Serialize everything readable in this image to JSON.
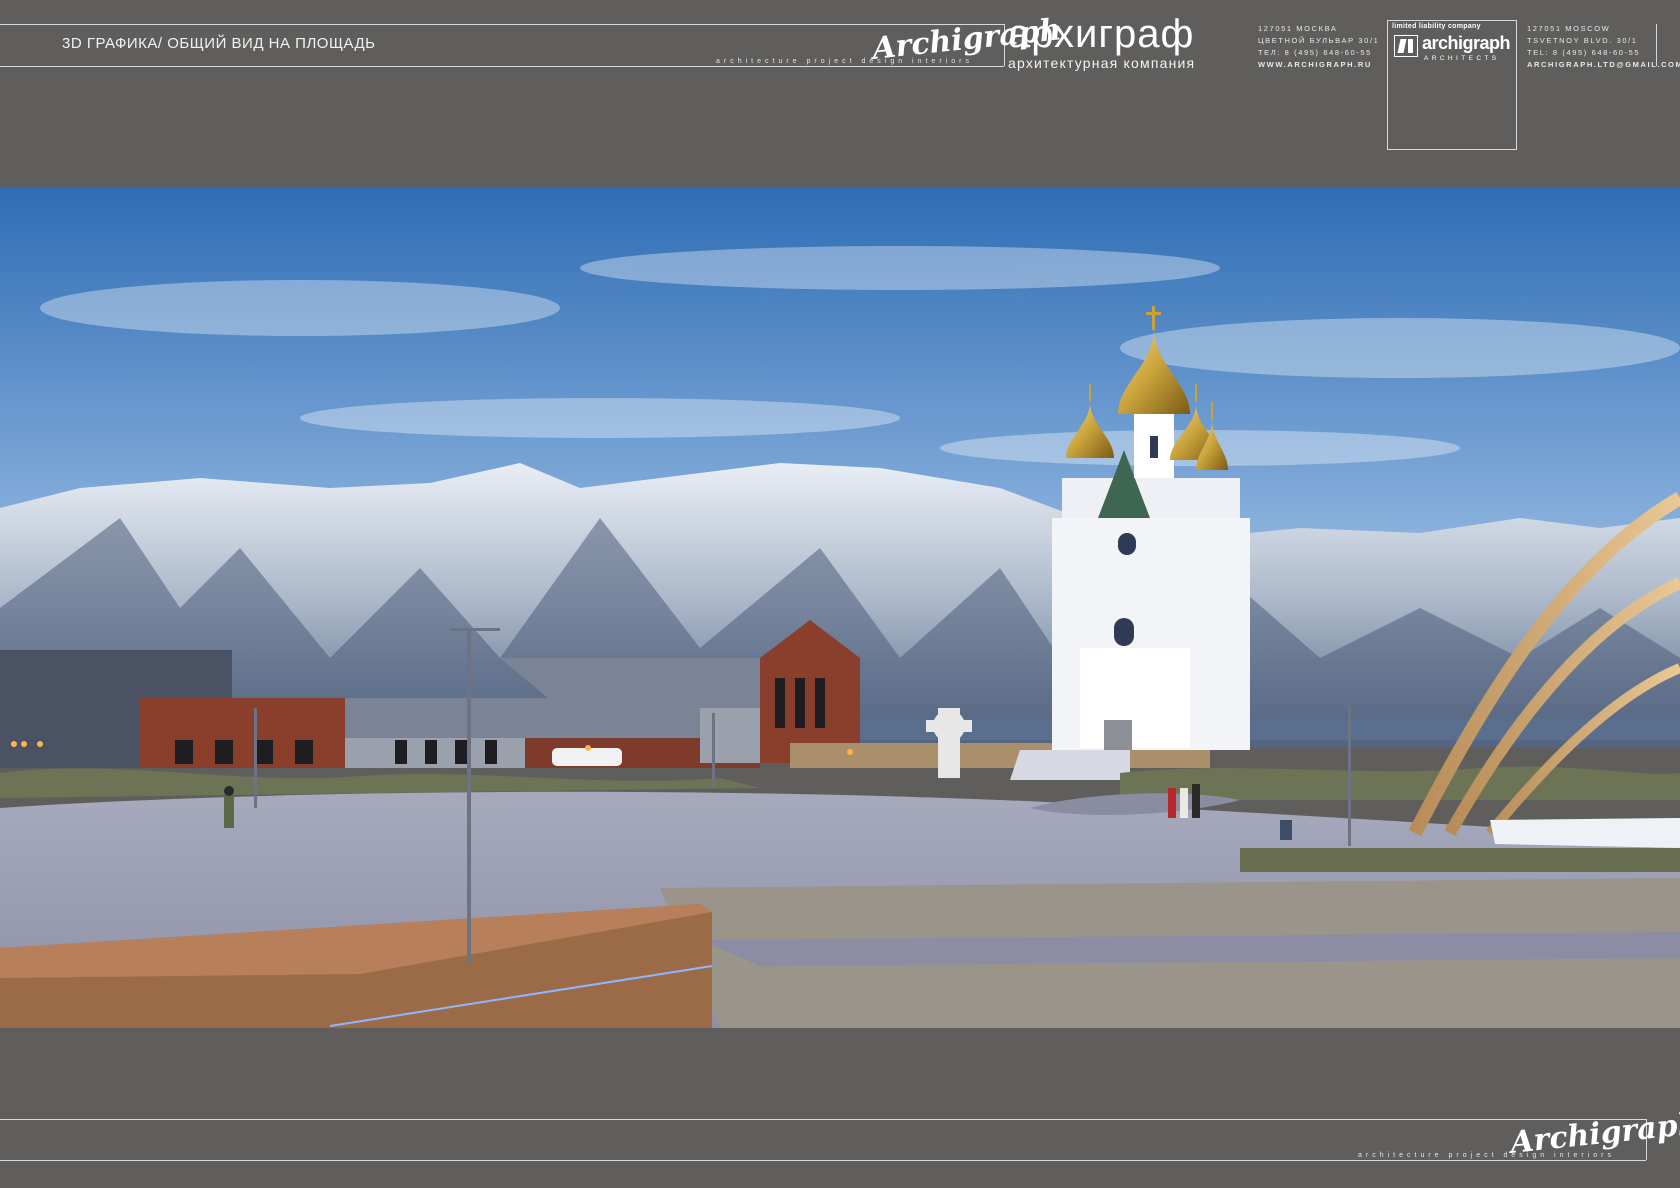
{
  "sheet": {
    "title": "3D ГРАФИКА/  ОБЩИЙ ВИД НА ПЛОЩАДЬ"
  },
  "studio": {
    "signature": "Archigraph",
    "tagline": "architecture project design interiors",
    "name_ru": "архиграф",
    "subtitle_ru": "архитектурная компания",
    "address_ru": [
      "127051 МОСКВА",
      "ЦВЕТНОЙ БУЛЬВАР 30/1",
      "ТЕЛ: 8 (495) 648-60-55",
      "WWW.ARCHIGRAPH.RU"
    ],
    "address_en": [
      "127051 MOSCOW",
      "TSVETNOY BLVD. 30/1",
      "TEL: 8 (495) 648-60-55",
      "ARCHIGRAPH.LTD@GMAIL.COM"
    ],
    "logo_caption": "limited liability company",
    "logo_word": "archigraph",
    "logo_sub": "ARCHITECTS"
  },
  "colors": {
    "background": "#5f5e5c",
    "frame_line": "#d9d9d9",
    "sky_top": "#2f6db5",
    "sky_bottom": "#c9dcef",
    "gold": "#c9a23a"
  },
  "icons": [
    "archigraph-logo-icon",
    "cross-icon"
  ]
}
